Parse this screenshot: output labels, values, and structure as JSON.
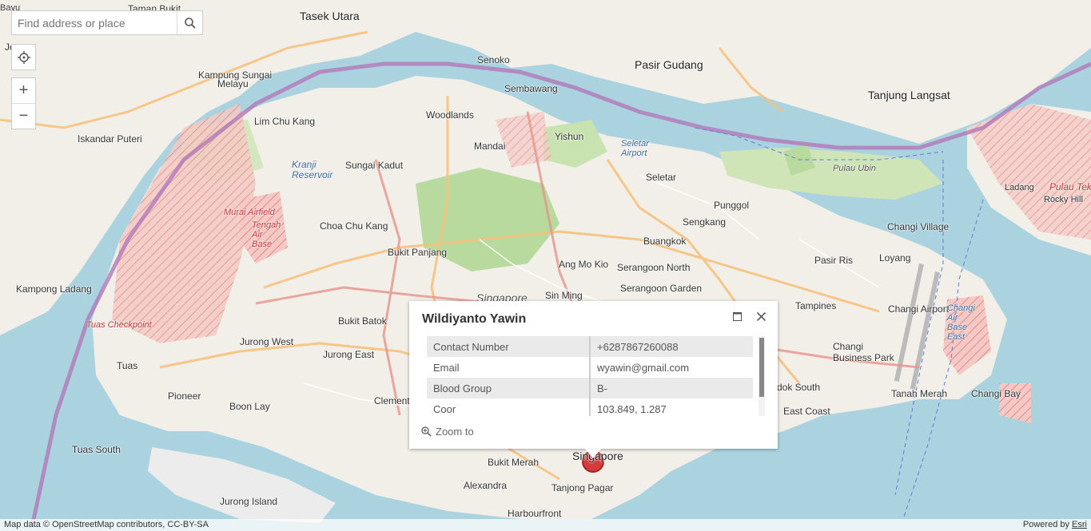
{
  "search": {
    "placeholder": "Find address or place"
  },
  "controls": {
    "zoom_in": "+",
    "zoom_out": "−"
  },
  "map_labels": {
    "tasek_utara": "Tasek Utara",
    "taman_bukit": "Taman Bukit",
    "kampung_sungai_melayu_1": "Kampung Sungai",
    "kampung_sungai_melayu_2": "Melayu",
    "lim_chu_kang": "Lim Chu Kang",
    "iskandar_puteri": "Iskandar Puteri",
    "sungai_kadut": "Sungai Kadut",
    "kranji_reservoir": "Kranji Reservoir",
    "choa_chu_kang": "Choa Chu Kang",
    "bukit_panjang": "Bukit Panjang",
    "kampong_ladang": "Kampong Ladang",
    "tengah_air_base": "Tengah Air Base",
    "murai_airfield": "Murai Airfield",
    "jurong_west": "Jurong West",
    "jurong_east": "Jurong East",
    "bukit_batok": "Bukit Batok",
    "tuas": "Tuas",
    "pioneer": "Pioneer",
    "boon_lay": "Boon Lay",
    "tuas_south": "Tuas South",
    "jurong_island": "Jurong Island",
    "clementi": "Clementi",
    "alexandra": "Alexandra",
    "bukit_merah": "Bukit Merah",
    "singapore_city": "Singapore",
    "tanjong_pagar": "Tanjong Pagar",
    "harbourfront": "Harbourfront",
    "senoko": "Senoko",
    "sembawang": "Sembawang",
    "woodlands": "Woodlands",
    "mandai": "Mandai",
    "yishun": "Yishun",
    "seletar_airport": "Seletar Airport",
    "seletar": "Seletar",
    "punggol": "Punggol",
    "sengkang": "Sengkang",
    "buangkok": "Buangkok",
    "ang_mo_kio": "Ang Mo Kio",
    "serangoon_north": "Serangoon North",
    "serangoon_garden": "Serangoon Garden",
    "sin_ming": "Sin Ming",
    "singapore_island": "Singapore",
    "pasir_gudang": "Pasir Gudang",
    "tanjung_langsat": "Tanjung Langsat",
    "pulau_ubin": "Pulau Ubin",
    "changi_village": "Changi Village",
    "loyang": "Loyang",
    "pasir_ris": "Pasir Ris",
    "tampines": "Tampines",
    "changi_airport": "Changi Airport",
    "changi_air_base_east": "Changi Air Base East",
    "changi_business_park": "Changi Business Park",
    "tanah_merah": "Tanah Merah",
    "changi_bay": "Changi Bay",
    "east_coast": "East Coast",
    "bedok_south": "dok South",
    "ladang": "Ladang",
    "rocky_hill": "Rocky Hill",
    "pulau_tekong": "Pulau Tek",
    "tuas_checkpoint": "Tuas Checkpoint",
    "jurong_partial": "Je",
    "bayu": "Bayu"
  },
  "popup": {
    "title": "Wildiyanto Yawin",
    "rows": [
      {
        "key": "Contact Number",
        "value": "+6287867260088"
      },
      {
        "key": "Email",
        "value": "wyawin@gmail.com"
      },
      {
        "key": "Blood Group",
        "value": "B-"
      },
      {
        "key": "Coor",
        "value": "103.849, 1.287"
      }
    ],
    "zoom_to": "Zoom to"
  },
  "attribution": {
    "left": "Map data © OpenStreetMap contributors, CC-BY-SA",
    "powered_by": "Powered by",
    "esri": "Esri"
  },
  "colors": {
    "water": "#aad3df",
    "land": "#f2efe9",
    "park": "#c8e3b0",
    "military": "#f4c9c5",
    "boundary": "#b278b8",
    "marker": "#d63a3a"
  }
}
